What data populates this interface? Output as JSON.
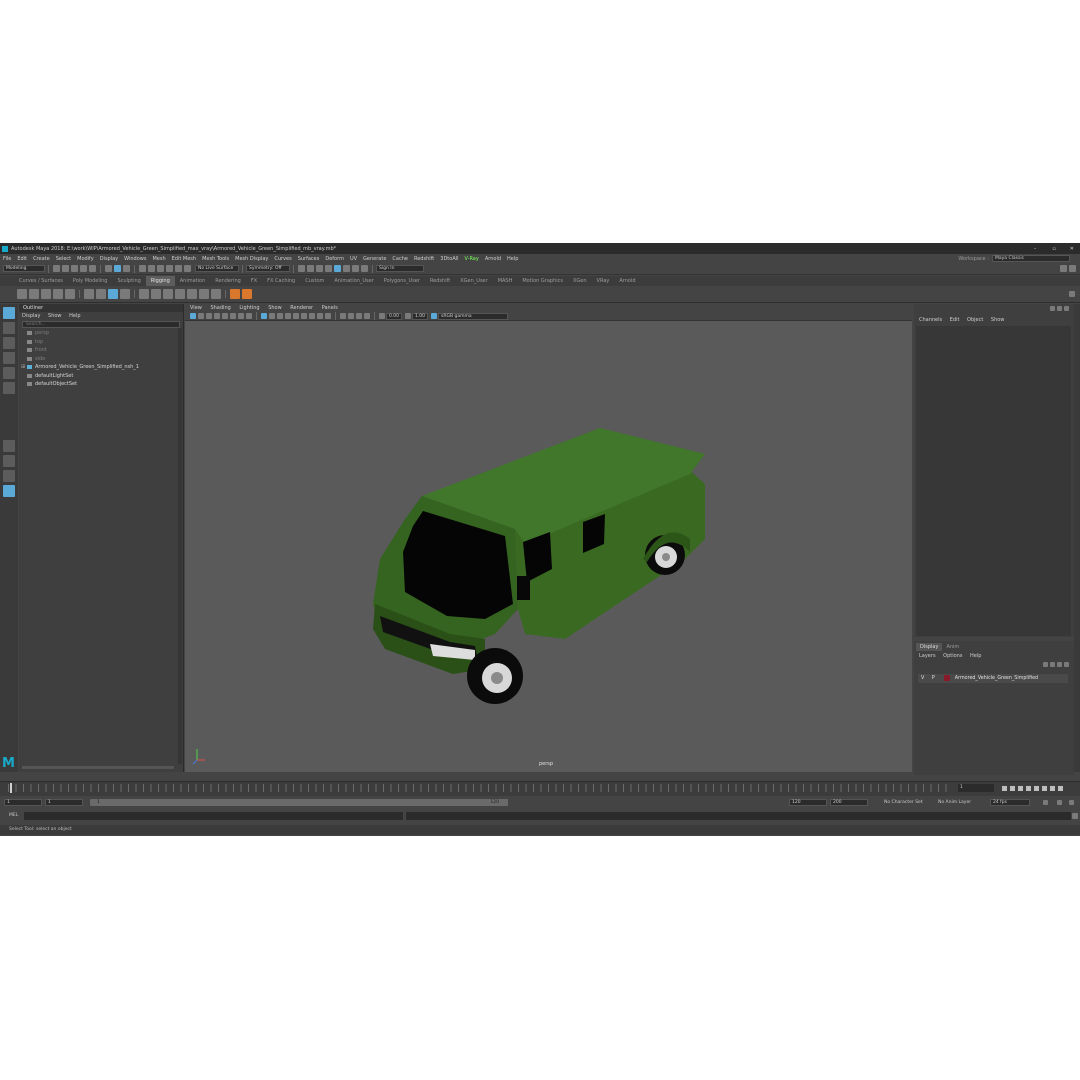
{
  "window": {
    "title": "Autodesk Maya 2018: E:\\work\\WIP\\Armored_Vehicle_Green_Simplified_max_vray\\Armored_Vehicle_Green_Simplified_mb_vray.mb*",
    "minimize": "–",
    "maximize": "▫",
    "close": "✕"
  },
  "menubar": {
    "items": [
      "File",
      "Edit",
      "Create",
      "Select",
      "Modify",
      "Display",
      "Windows",
      "Mesh",
      "Edit Mesh",
      "Mesh Tools",
      "Mesh Display",
      "Curves",
      "Surfaces",
      "Deform",
      "UV",
      "Generate",
      "Cache",
      "Redshift",
      "3DtoAll",
      "V-Ray",
      "Arnold",
      "Help"
    ],
    "workspace_label": "Workspace :",
    "workspace_value": "Maya Classic"
  },
  "statusline": {
    "mode": "Modeling",
    "live_surface": "No Live Surface",
    "symmetry": "Symmetry: Off",
    "signin": "Sign In"
  },
  "shelf": {
    "tabs": [
      "Curves / Surfaces",
      "Poly Modeling",
      "Sculpting",
      "Rigging",
      "Animation",
      "Rendering",
      "FX",
      "FX Caching",
      "Custom",
      "Animation_User",
      "Polygons_User",
      "Redshift",
      "XGen_User",
      "MASH",
      "Motion Graphics",
      "XGen",
      "VRay",
      "Arnold"
    ],
    "active_tab": "Rigging"
  },
  "outliner": {
    "title": "Outliner",
    "menu": [
      "Display",
      "Show",
      "Help"
    ],
    "search_placeholder": "Search...",
    "items": [
      {
        "label": "persp",
        "dim": true
      },
      {
        "label": "top",
        "dim": true
      },
      {
        "label": "front",
        "dim": true
      },
      {
        "label": "side",
        "dim": true
      },
      {
        "label": "Armored_Vehicle_Green_Simplified_nsh_1",
        "dim": false
      },
      {
        "label": "defaultLightSet",
        "dim": false
      },
      {
        "label": "defaultObjectSet",
        "dim": false
      }
    ]
  },
  "viewport": {
    "menu": [
      "View",
      "Shading",
      "Lighting",
      "Show",
      "Renderer",
      "Panels"
    ],
    "field_a": "0.00",
    "field_b": "1.00",
    "colorspace": "sRGB gamma",
    "camera_label": "persp"
  },
  "channelbox": {
    "menu": [
      "Channels",
      "Edit",
      "Object",
      "Show"
    ]
  },
  "layers": {
    "tabs": [
      "Display",
      "Anim"
    ],
    "menu": [
      "Layers",
      "Options",
      "Help"
    ],
    "v_flag": "V",
    "p_flag": "P",
    "layer_name": "Armored_Vehicle_Green_Simplified",
    "layer_color": "#8a1a2a"
  },
  "timeline": {
    "ticks": [
      "5",
      "10",
      "15",
      "20",
      "25",
      "30",
      "35",
      "40",
      "45",
      "50",
      "55",
      "60",
      "65",
      "70",
      "75",
      "80",
      "85",
      "90",
      "95",
      "100",
      "105",
      "110",
      "115",
      "120"
    ],
    "current_frame": "1"
  },
  "range": {
    "start": "1",
    "start_b": "1",
    "slider_start": "1",
    "slider_end": "120",
    "end": "120",
    "end_b": "200",
    "character_set": "No Character Set",
    "anim_layer": "No Anim Layer",
    "fps": "24 fps"
  },
  "command": {
    "label": "MEL"
  },
  "help": {
    "text": "Select Tool: select an object"
  },
  "vehicle": {
    "body_color": "#3a6a22",
    "body_shade": "#2c5518",
    "glass_color": "#050505"
  }
}
